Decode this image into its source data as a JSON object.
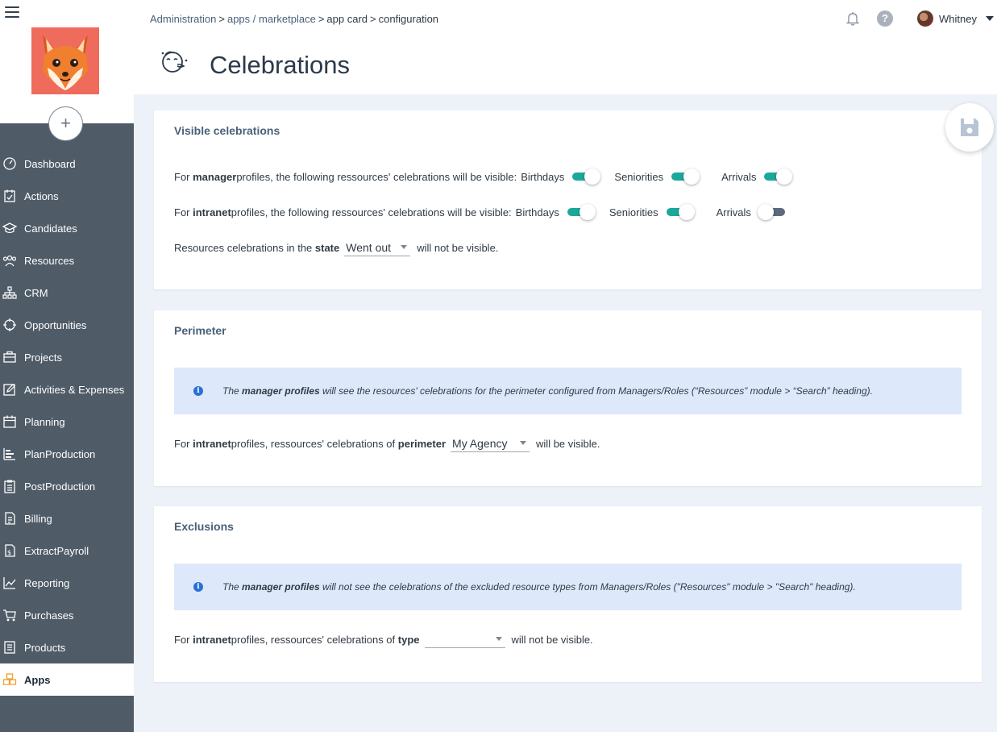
{
  "breadcrumb": {
    "admin": "Administration",
    "apps": "apps / marketplace",
    "card": "app card",
    "config": "configuration"
  },
  "user": {
    "name": "Whitney"
  },
  "page": {
    "title": "Celebrations"
  },
  "sidebar": {
    "items": [
      {
        "label": "Dashboard",
        "icon": "dashboard-icon"
      },
      {
        "label": "Actions",
        "icon": "actions-icon"
      },
      {
        "label": "Candidates",
        "icon": "graduation-cap-icon"
      },
      {
        "label": "Resources",
        "icon": "people-icon"
      },
      {
        "label": "CRM",
        "icon": "sitemap-icon"
      },
      {
        "label": "Opportunities",
        "icon": "crosshair-icon"
      },
      {
        "label": "Projects",
        "icon": "briefcase-icon"
      },
      {
        "label": "Activities & Expenses",
        "icon": "edit-icon"
      },
      {
        "label": "Planning",
        "icon": "calendar-icon"
      },
      {
        "label": "PlanProduction",
        "icon": "gantt-icon"
      },
      {
        "label": "PostProduction",
        "icon": "clipboard-icon"
      },
      {
        "label": "Billing",
        "icon": "invoice-icon"
      },
      {
        "label": "ExtractPayroll",
        "icon": "payroll-icon"
      },
      {
        "label": "Reporting",
        "icon": "chart-icon"
      },
      {
        "label": "Purchases",
        "icon": "cart-icon"
      },
      {
        "label": "Products",
        "icon": "book-icon"
      },
      {
        "label": "Apps",
        "icon": "cubes-icon"
      }
    ],
    "active": "Apps"
  },
  "visible": {
    "title": "Visible celebrations",
    "manager": {
      "pre": "For ",
      "bold": "manager",
      "post": " profiles, the following ressources' celebrations will be visible:"
    },
    "intranet": {
      "pre": "For ",
      "bold": "intranet",
      "post": " profiles, the following ressources' celebrations will be visible:"
    },
    "birthdays": "Birthdays",
    "seniorities": "Seniorities",
    "arrivals": "Arrivals",
    "manager_toggles": {
      "birthdays": true,
      "seniorities": true,
      "arrivals": true
    },
    "intranet_toggles": {
      "birthdays": true,
      "seniorities": true,
      "arrivals": false
    },
    "state": {
      "pre": "Resources celebrations in the ",
      "bold": "state",
      "value": "Went out",
      "post": "will not be visible."
    }
  },
  "perimeter": {
    "title": "Perimeter",
    "info": {
      "pre": "The ",
      "bold": "manager profiles",
      "post": " will see the resources' celebrations for the perimeter configured from Managers/Roles (“Resources” module > “Search” heading)."
    },
    "row": {
      "pre": "For ",
      "bold1": "intranet",
      "mid": " profiles, ressources' celebrations of ",
      "bold2": "perimeter",
      "value": "My Agency",
      "post": "will be visible."
    }
  },
  "exclusions": {
    "title": "Exclusions",
    "info": {
      "pre": "The ",
      "bold": "manager profiles",
      "post": " will not see the celebrations of the excluded resource types from Managers/Roles (\"Resources\" module > \"Search\" heading)."
    },
    "row": {
      "pre": "For ",
      "bold1": "intranet",
      "mid": " profiles, ressources' celebrations of ",
      "bold2": "type",
      "value": "",
      "post": "will not be visible."
    }
  },
  "colors": {
    "accent": "#1aa89a",
    "sidebar": "#4f5b67",
    "info_bg": "#dde8fb",
    "apps_icon": "#f0a030"
  }
}
